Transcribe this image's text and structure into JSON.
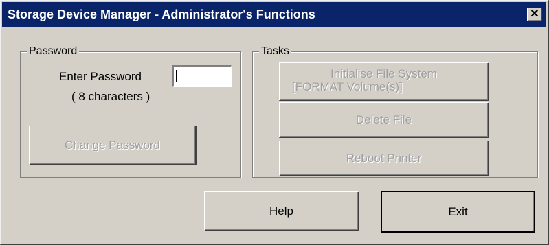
{
  "window": {
    "title": "Storage Device Manager - Administrator's Functions",
    "close_glyph": "✕",
    "close_icon": "close-icon"
  },
  "password_group": {
    "legend": "Password",
    "enter_label": "Enter Password",
    "hint": "( 8 characters )",
    "password_value": "",
    "change_button": "Change Password"
  },
  "tasks_group": {
    "legend": "Tasks",
    "init_line1": "Initialise File System",
    "init_line2": "[FORMAT Volume(s)]",
    "delete_button": "Delete File",
    "reboot_button": "Reboot Printer"
  },
  "footer": {
    "help_button": "Help",
    "exit_button": "Exit"
  }
}
